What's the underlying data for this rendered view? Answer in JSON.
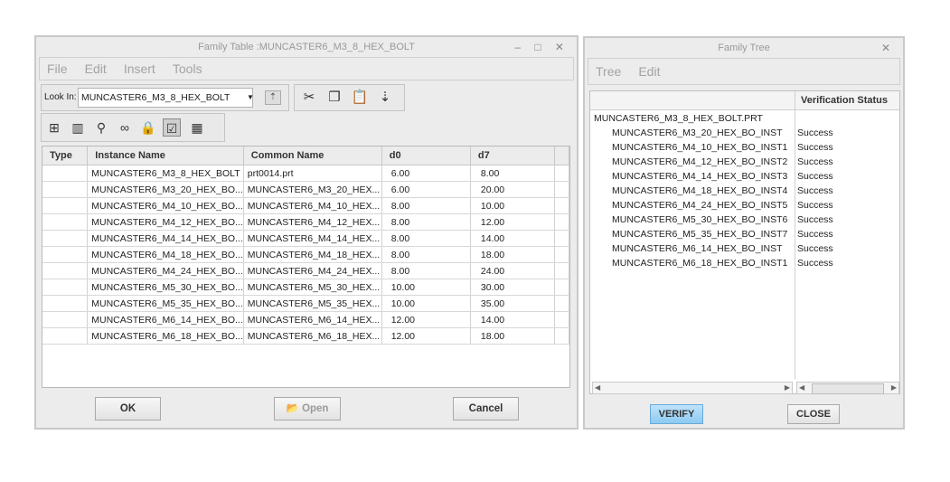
{
  "family_table": {
    "title": "Family Table :MUNCASTER6_M3_8_HEX_BOLT",
    "window_controls": "– □ ✕",
    "menu": [
      "File",
      "Edit",
      "Insert",
      "Tools"
    ],
    "look_in_label": "Look In:",
    "look_in_value": "MUNCASTER6_M3_8_HEX_BOLT",
    "columns": [
      "Type",
      "Instance Name",
      "Common Name",
      "d0",
      "d7"
    ],
    "rows": [
      [
        "",
        "MUNCASTER6_M3_8_HEX_BOLT",
        "prt0014.prt",
        "6.00",
        "8.00"
      ],
      [
        "",
        "MUNCASTER6_M3_20_HEX_BO...",
        "MUNCASTER6_M3_20_HEX...",
        "6.00",
        "20.00"
      ],
      [
        "",
        "MUNCASTER6_M4_10_HEX_BO...",
        "MUNCASTER6_M4_10_HEX...",
        "8.00",
        "10.00"
      ],
      [
        "",
        "MUNCASTER6_M4_12_HEX_BO...",
        "MUNCASTER6_M4_12_HEX...",
        "8.00",
        "12.00"
      ],
      [
        "",
        "MUNCASTER6_M4_14_HEX_BO...",
        "MUNCASTER6_M4_14_HEX...",
        "8.00",
        "14.00"
      ],
      [
        "",
        "MUNCASTER6_M4_18_HEX_BO...",
        "MUNCASTER6_M4_18_HEX...",
        "8.00",
        "18.00"
      ],
      [
        "",
        "MUNCASTER6_M4_24_HEX_BO...",
        "MUNCASTER6_M4_24_HEX...",
        "8.00",
        "24.00"
      ],
      [
        "",
        "MUNCASTER6_M5_30_HEX_BO...",
        "MUNCASTER6_M5_30_HEX...",
        "10.00",
        "30.00"
      ],
      [
        "",
        "MUNCASTER6_M5_35_HEX_BO...",
        "MUNCASTER6_M5_35_HEX...",
        "10.00",
        "35.00"
      ],
      [
        "",
        "MUNCASTER6_M6_14_HEX_BO...",
        "MUNCASTER6_M6_14_HEX...",
        "12.00",
        "14.00"
      ],
      [
        "",
        "MUNCASTER6_M6_18_HEX_BO...",
        "MUNCASTER6_M6_18_HEX...",
        "12.00",
        "18.00"
      ]
    ],
    "ok_label": "OK",
    "open_label": "Open",
    "cancel_label": "Cancel"
  },
  "family_tree": {
    "title": "Family Tree",
    "close_glyph": "✕",
    "menu": [
      "Tree",
      "Edit"
    ],
    "status_header": "Verification Status",
    "root": "MUNCASTER6_M3_8_HEX_BOLT.PRT",
    "items": [
      {
        "name": "MUNCASTER6_M3_20_HEX_BO_INST",
        "status": "Success"
      },
      {
        "name": "MUNCASTER6_M4_10_HEX_BO_INST1",
        "status": "Success"
      },
      {
        "name": "MUNCASTER6_M4_12_HEX_BO_INST2",
        "status": "Success"
      },
      {
        "name": "MUNCASTER6_M4_14_HEX_BO_INST3",
        "status": "Success"
      },
      {
        "name": "MUNCASTER6_M4_18_HEX_BO_INST4",
        "status": "Success"
      },
      {
        "name": "MUNCASTER6_M4_24_HEX_BO_INST5",
        "status": "Success"
      },
      {
        "name": "MUNCASTER6_M5_30_HEX_BO_INST6",
        "status": "Success"
      },
      {
        "name": "MUNCASTER6_M5_35_HEX_BO_INST7",
        "status": "Success"
      },
      {
        "name": "MUNCASTER6_M6_14_HEX_BO_INST",
        "status": "Success"
      },
      {
        "name": "MUNCASTER6_M6_18_HEX_BO_INST1",
        "status": "Success"
      }
    ],
    "verify_label": "VERIFY",
    "close_label": "CLOSE"
  }
}
